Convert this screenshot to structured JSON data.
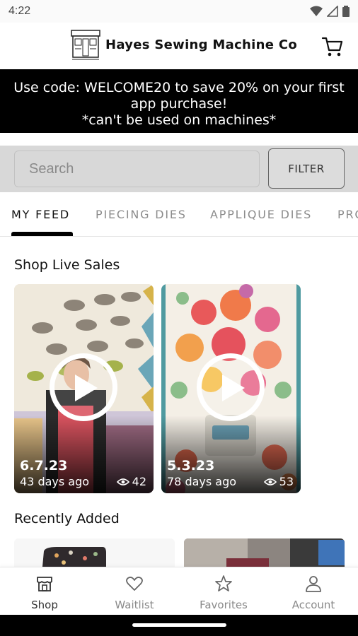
{
  "status_bar": {
    "time": "4:22",
    "icons": [
      "wifi-icon",
      "signal-icon",
      "battery-icon"
    ]
  },
  "header": {
    "brand_name": "Hayes Sewing Machine Co",
    "logo_icon": "storefront-logo",
    "cart_icon": "cart-icon"
  },
  "promo": {
    "line1": "Use code: WELCOME20 to save 20% on your first",
    "line2": "app purchase!",
    "line3": "*can't be used on machines*"
  },
  "search": {
    "placeholder": "Search",
    "filter_label": "FILTER"
  },
  "tabs": [
    {
      "label": "MY FEED",
      "active": true
    },
    {
      "label": "PIECING DIES",
      "active": false
    },
    {
      "label": "APPLIQUE DIES",
      "active": false
    },
    {
      "label": "PRO",
      "active": false
    }
  ],
  "live_sales": {
    "title": "Shop Live Sales",
    "videos": [
      {
        "date": "6.7.23",
        "ago": "43 days ago",
        "views": "42"
      },
      {
        "date": "5.3.23",
        "ago": "78 days ago",
        "views": "53"
      }
    ]
  },
  "recently_added": {
    "title": "Recently Added"
  },
  "bottom_nav": [
    {
      "label": "Shop",
      "icon": "shop-icon",
      "active": true
    },
    {
      "label": "Waitlist",
      "icon": "heart-icon",
      "active": false
    },
    {
      "label": "Favorites",
      "icon": "star-icon",
      "active": false
    },
    {
      "label": "Account",
      "icon": "person-icon",
      "active": false
    }
  ],
  "colors": {
    "promo_bg": "#000000",
    "search_band": "#d8d8d8",
    "active_tab": "#111111",
    "inactive_tab": "#8c8c8c"
  }
}
